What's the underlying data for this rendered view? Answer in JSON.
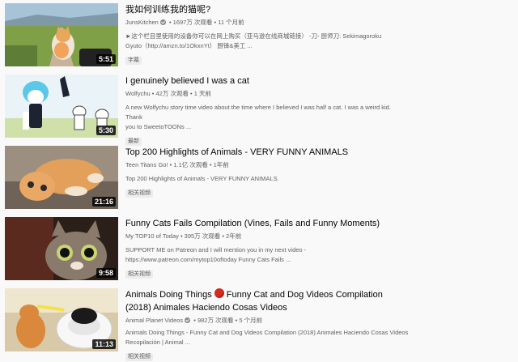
{
  "results": [
    {
      "title": "我如何训练我的猫呢?",
      "channel": "JunsKitchen",
      "stats": " • 1697万 次观看 • 11 个月前",
      "description_line1": "►这个栏目里使用的设备你可以在网上购买（亚马逊在线商城链接） -刀- 厨师刀: Sekimagoroku",
      "description_line2": "Gyuto（http://amzn.to/1OkxnYt） 厨锋&美工 ...",
      "badge": "字幕",
      "duration": "5:51"
    },
    {
      "title": "I genuinely believed I was a cat",
      "channel": "Wolfychu",
      "stats": " • 42万 次观看 • 1 天前",
      "description_line1": "A new Wolfychu story time video about the time where I believed I was half a cat. I was a weird kid. Thank",
      "description_line2": "you to SweetoTOONs ...",
      "badge": "最新",
      "duration": "5:30"
    },
    {
      "title": "Top 200 Highlights of Animals - VERY FUNNY ANIMALS",
      "channel": "Teen Titans Go!",
      "stats": " • 1.1亿 次观看 • 1年前",
      "description_line1": "Top 200 Highlights of Animals - VERY FUNNY ANIMALS.",
      "description_line2": "",
      "badge": "相关视频",
      "duration": "21:16"
    },
    {
      "title": "Funny Cats Fails Compilation (Vines, Fails and Funny Moments)",
      "channel": "My TOP10 of Today",
      "stats": " • 395万 次观看 • 2年前",
      "description_line1": "SUPPORT ME on Patreon and I will mention you in my next video -",
      "description_line2": "https://www.patreon.com/mytop10oftoday Funny Cats Fails ...",
      "badge": "相关视频",
      "duration": "9:58"
    },
    {
      "title_part1": "Animals Doing Things",
      "title_part2": "Funny Cat and Dog Videos Compilation",
      "title_line2": "(2018) Animales Haciendo Cosas Videos",
      "channel": "Animal Planet Videos",
      "stats": " • 982万 次观看 • 5 个月前",
      "description_line1": "Animals Doing Things - Funny Cat and Dog Videos Compilation (2018) Animales Haciendo Cosas Videos",
      "description_line2": "Recopilación | Animal ...",
      "badge": "相关视频",
      "duration": "11:13"
    }
  ],
  "colors": {
    "background": "#f9f9f9",
    "title": "#030303",
    "meta": "#606060",
    "badge_bg": "#ececec",
    "red_circle": "#d62b1e"
  }
}
